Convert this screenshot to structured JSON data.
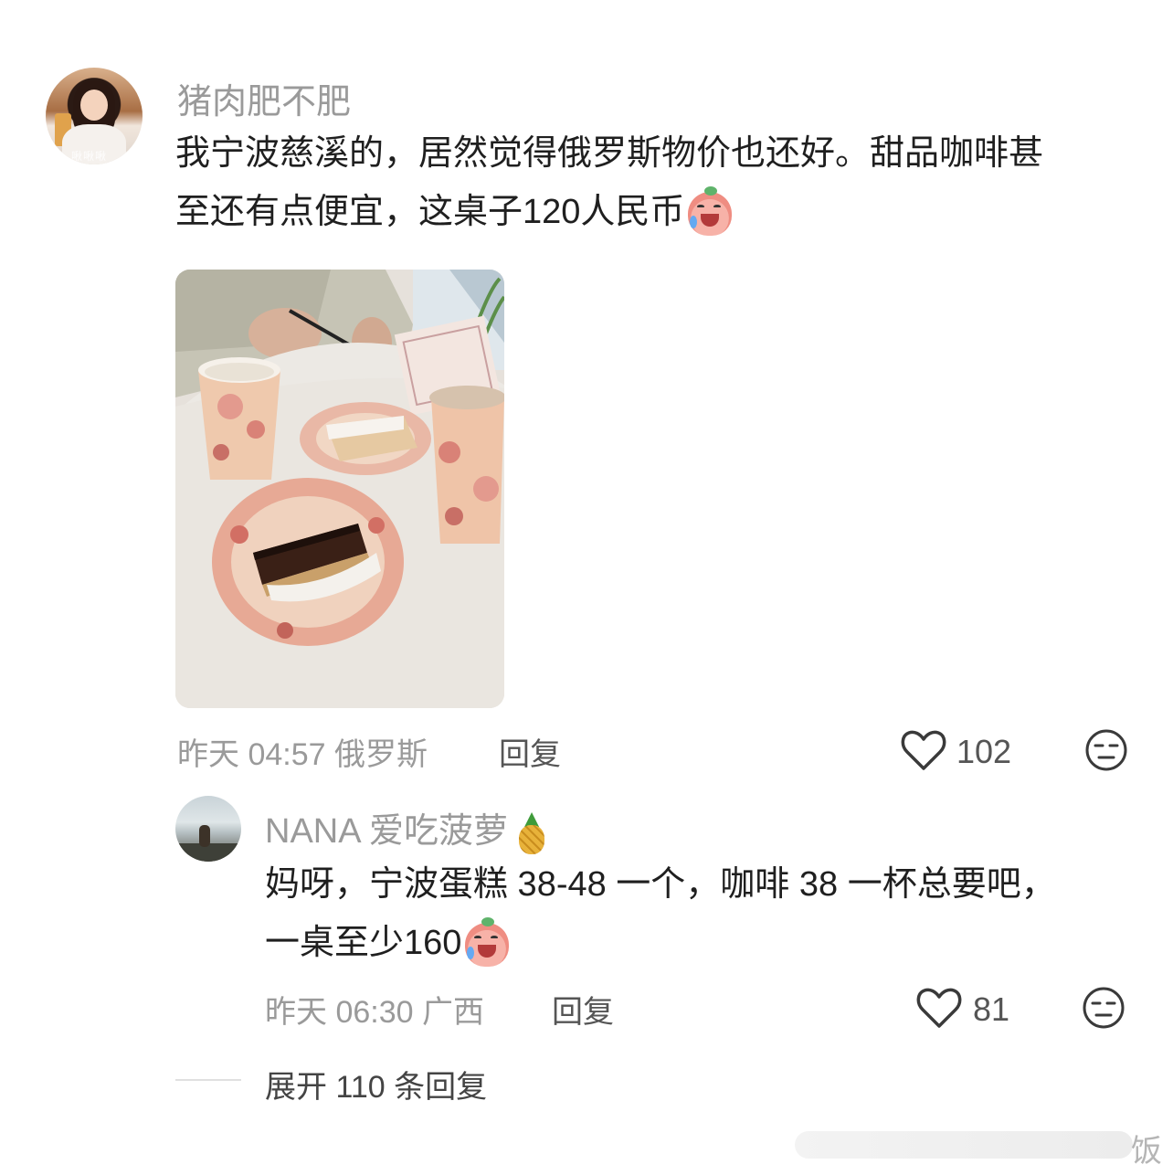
{
  "comment": {
    "username": "猪肉肥不肥",
    "avatar_watermark": "啾啾啾",
    "text_line1": "我宁波慈溪的，居然觉得俄罗斯物价也还好。甜品咖啡甚",
    "text_line2": "至还有点便宜，这桌子120人民币",
    "emoji": "crying-blob-emoji",
    "meta": "昨天 04:57 俄罗斯",
    "reply_label": "回复",
    "like_count": "102"
  },
  "reply": {
    "username": "NANA 爱吃菠萝",
    "username_emoji": "pineapple-emoji",
    "text_line1": "妈呀，宁波蛋糕 38-48 一个，咖啡 38 一杯总要吧，",
    "text_line2": "一桌至少160",
    "emoji": "crying-blob-emoji",
    "meta": "昨天 06:30 广西",
    "reply_label": "回复",
    "like_count": "81"
  },
  "expand_replies": "展开 110 条回复",
  "corner_char": "饭",
  "icons": {
    "like": "heart-outline-icon",
    "react": "neutral-face-icon"
  },
  "colors": {
    "text_primary": "#1f1f1f",
    "text_muted": "#9a9a9a",
    "text_secondary": "#555555"
  }
}
